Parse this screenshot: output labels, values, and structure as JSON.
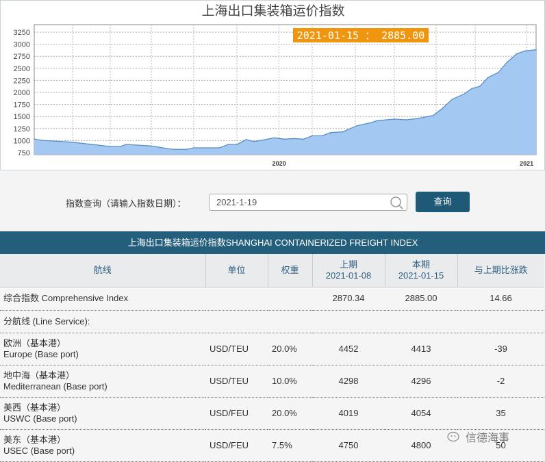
{
  "chart": {
    "tooltip": "2021-01-15 ： 2885.00",
    "tooltip_color": "#f0960e",
    "fill_color": "#a3c8f2",
    "line_color": "#5b8fc4"
  },
  "chart_data": {
    "type": "area",
    "title": "上海出口集装箱运价指数",
    "xlim": [
      "2019-01-04",
      "2021-01-15"
    ],
    "ylim": [
      750,
      3350
    ],
    "y_ticks": [
      750,
      1000,
      1250,
      1500,
      1750,
      2000,
      2250,
      2500,
      2750,
      3000,
      3250
    ],
    "x_tick_labels": [
      {
        "label": "2020",
        "date": "2020-01-01"
      },
      {
        "label": "2021",
        "date": "2021-01-01"
      }
    ],
    "grid": true,
    "points": [
      [
        "2019-01-04",
        1034
      ],
      [
        "2019-01-15",
        1006
      ],
      [
        "2019-03-01",
        967
      ],
      [
        "2019-04-26",
        878
      ],
      [
        "2019-05-12",
        878
      ],
      [
        "2019-05-20",
        920
      ],
      [
        "2019-06-26",
        888
      ],
      [
        "2019-07-26",
        821
      ],
      [
        "2019-08-16",
        817
      ],
      [
        "2019-08-28",
        849
      ],
      [
        "2019-10-05",
        849
      ],
      [
        "2019-10-18",
        920
      ],
      [
        "2019-10-31",
        920
      ],
      [
        "2019-11-13",
        1020
      ],
      [
        "2019-11-25",
        981
      ],
      [
        "2019-12-10",
        1015
      ],
      [
        "2019-12-25",
        1058
      ],
      [
        "2020-01-09",
        1030
      ],
      [
        "2020-01-23",
        1043
      ],
      [
        "2020-02-06",
        1030
      ],
      [
        "2020-02-19",
        1100
      ],
      [
        "2020-03-05",
        1100
      ],
      [
        "2020-03-17",
        1166
      ],
      [
        "2020-04-04",
        1180
      ],
      [
        "2020-04-25",
        1308
      ],
      [
        "2020-05-15",
        1370
      ],
      [
        "2020-05-25",
        1413
      ],
      [
        "2020-06-19",
        1446
      ],
      [
        "2020-07-07",
        1432
      ],
      [
        "2020-07-23",
        1456
      ],
      [
        "2020-08-16",
        1521
      ],
      [
        "2020-08-29",
        1663
      ],
      [
        "2020-09-13",
        1858
      ],
      [
        "2020-09-30",
        1962
      ],
      [
        "2020-10-12",
        2080
      ],
      [
        "2020-10-24",
        2128
      ],
      [
        "2020-11-05",
        2312
      ],
      [
        "2020-11-20",
        2412
      ],
      [
        "2020-12-03",
        2625
      ],
      [
        "2020-12-17",
        2800
      ],
      [
        "2020-12-30",
        2862
      ],
      [
        "2021-01-15",
        2885
      ]
    ]
  },
  "query": {
    "label": "指数查询（请输入指数日期）：",
    "value": "2021-1-19",
    "button": "查询"
  },
  "table": {
    "title": "上海出口集装箱运价指数SHANGHAI CONTAINERIZED FREIGHT INDEX",
    "headers": [
      "航线",
      "单位",
      "权重",
      "上期",
      "本期",
      "与上期比涨跌"
    ],
    "prev_date": "2021-01-08",
    "cur_date": "2021-01-15",
    "comprehensive": {
      "name": "综合指数 Comprehensive Index",
      "prev": "2870.34",
      "cur": "2885.00",
      "change": "14.66"
    },
    "section": "分航线 (Line Service):",
    "rows": [
      {
        "cn": "欧洲（基本港）",
        "en": "Europe (Base port)",
        "unit": "USD/TEU",
        "weight": "20.0%",
        "prev": "4452",
        "cur": "4413",
        "change": "-39"
      },
      {
        "cn": "地中海（基本港）",
        "en": "Mediterranean (Base port)",
        "unit": "USD/TEU",
        "weight": "10.0%",
        "prev": "4298",
        "cur": "4296",
        "change": "-2"
      },
      {
        "cn": "美西（基本港）",
        "en": "USWC (Base port)",
        "unit": "USD/FEU",
        "weight": "20.0%",
        "prev": "4019",
        "cur": "4054",
        "change": "35"
      },
      {
        "cn": "美东（基本港）",
        "en": "USEC (Base port)",
        "unit": "USD/FEU",
        "weight": "7.5%",
        "prev": "4750",
        "cur": "4800",
        "change": "50"
      }
    ]
  },
  "watermark": {
    "text": "信德海事",
    "icon": "wechat-icon"
  }
}
